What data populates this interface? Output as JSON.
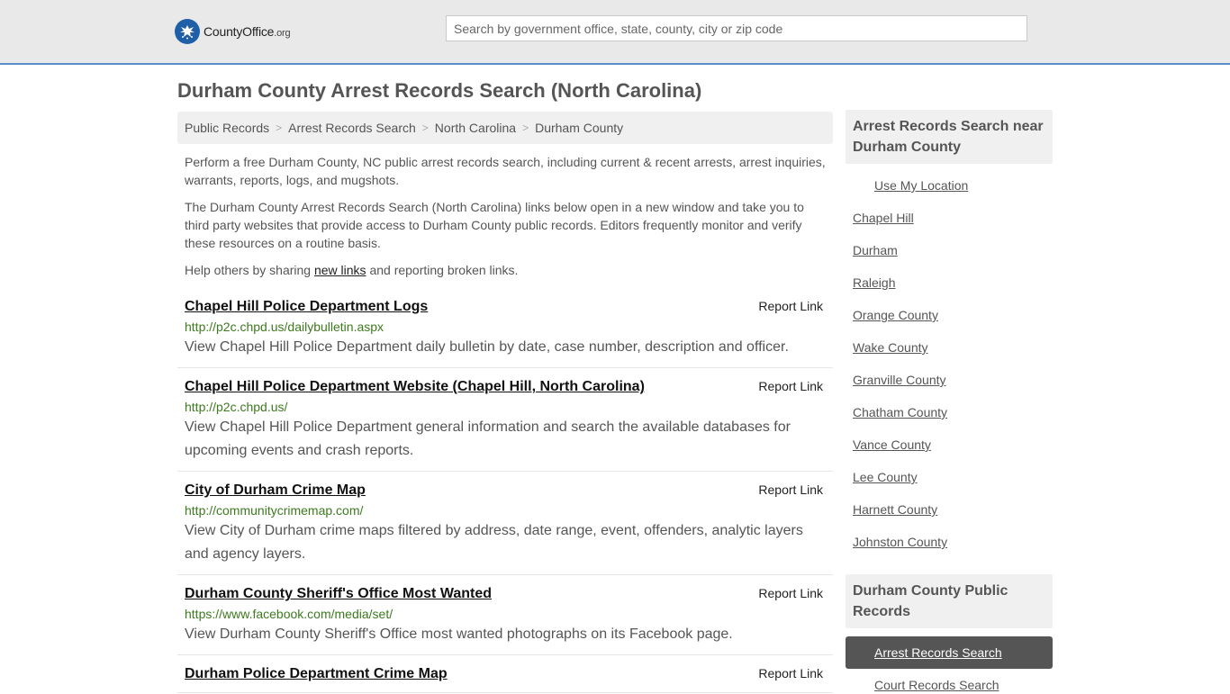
{
  "header": {
    "logo_text": "CountyOffice",
    "logo_suffix": ".org",
    "search_placeholder": "Search by government office, state, county, city or zip code"
  },
  "page_title": "Durham County Arrest Records Search (North Carolina)",
  "breadcrumb": [
    "Public Records",
    "Arrest Records Search",
    "North Carolina",
    "Durham County"
  ],
  "intro": {
    "p1": "Perform a free Durham County, NC public arrest records search, including current & recent arrests, arrest inquiries, warrants, reports, logs, and mugshots.",
    "p2": "The Durham County Arrest Records Search (North Carolina) links below open in a new window and take you to third party websites that provide access to Durham County public records. Editors frequently monitor and verify these resources on a routine basis.",
    "p3_before": "Help others by sharing ",
    "p3_link": "new links",
    "p3_after": " and reporting broken links."
  },
  "report_label": "Report Link",
  "records": [
    {
      "title": "Chapel Hill Police Department Logs",
      "url": "http://p2c.chpd.us/dailybulletin.aspx",
      "desc": "View Chapel Hill Police Department daily bulletin by date, case number, description and officer."
    },
    {
      "title": "Chapel Hill Police Department Website (Chapel Hill, North Carolina)",
      "url": "http://p2c.chpd.us/",
      "desc": "View Chapel Hill Police Department general information and search the available databases for upcoming events and crash reports."
    },
    {
      "title": "City of Durham Crime Map",
      "url": "http://communitycrimemap.com/",
      "desc": "View City of Durham crime maps filtered by address, date range, event, offenders, analytic layers and agency layers."
    },
    {
      "title": "Durham County Sheriff's Office Most Wanted",
      "url": "https://www.facebook.com/media/set/",
      "desc": "View Durham County Sheriff's Office most wanted photographs on its Facebook page."
    },
    {
      "title": "Durham Police Department Crime Map",
      "url": "",
      "desc": ""
    }
  ],
  "sidebar": {
    "near_title": "Arrest Records Search near Durham County",
    "use_location": "Use My Location",
    "near_items": [
      "Chapel Hill",
      "Durham",
      "Raleigh",
      "Orange County",
      "Wake County",
      "Granville County",
      "Chatham County",
      "Vance County",
      "Lee County",
      "Harnett County",
      "Johnston County"
    ],
    "public_title": "Durham County Public Records",
    "active_item": "Arrest Records Search",
    "next_item": "Court Records Search"
  },
  "colors": {
    "accent": "#5a8ec9",
    "logo_blue": "#1f5fa8",
    "url_green": "#3d7a1e",
    "active_bg": "#555555"
  }
}
